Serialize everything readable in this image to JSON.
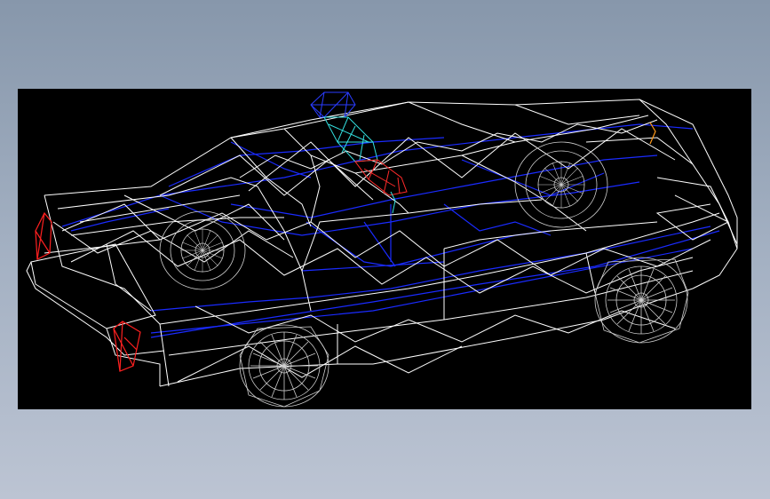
{
  "scene": {
    "background_gradient_top": "#8797ab",
    "background_gradient_bottom": "#bcc4d3",
    "viewport_background": "#000000"
  },
  "model": {
    "kind": "wireframe-car-model",
    "render_style": "wireframe",
    "colors": {
      "body": "#ffffff",
      "hidden_edges": "#1a2bff",
      "wheels": "#cfcfcf",
      "light_bar_top": "#2a3cff",
      "light_bar_mid": "#33e0e0",
      "light_bar_base": "#ff2a2a",
      "tail_lights": "#ff2020",
      "front_marker": "#ff9a1a"
    },
    "icons": [
      "police-light-bar-icon"
    ]
  }
}
